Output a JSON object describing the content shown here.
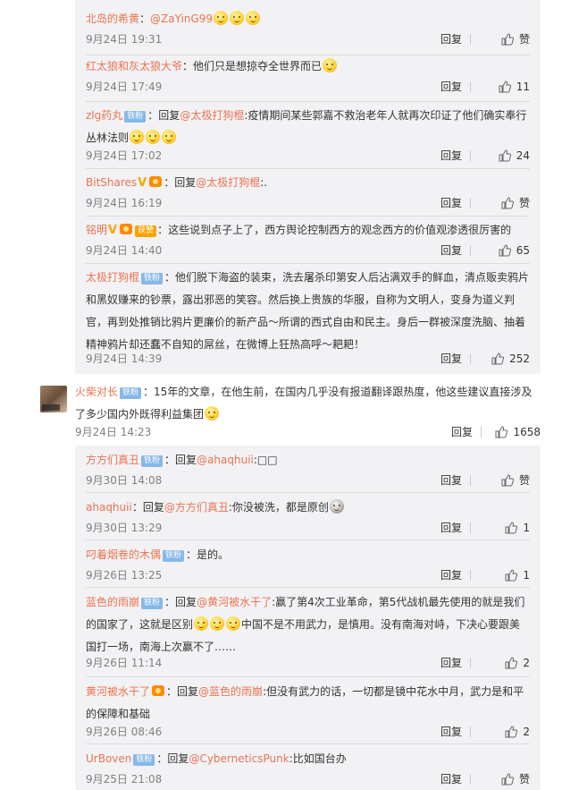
{
  "replies_top": [
    {
      "user": "北岛的希黄",
      "sep": "：",
      "at": "@ZaYinG99",
      "text": "",
      "emojis": 3,
      "time": "9月24日 19:31",
      "likes": "赞"
    },
    {
      "user": "红太狼和灰太狼大爷",
      "sep": "：",
      "text": "他们只是想掠夺全世界而已",
      "emojis_after": 1,
      "time": "9月24日 17:49",
      "likes": "11"
    },
    {
      "user": "zlg药丸",
      "badge": "铁粉",
      "sep": "：",
      "prefix": "回复",
      "at": "@太极打狗棍",
      "text": ":疫情期间某些郭嘉不救治老年人就再次印证了他们确实奉行丛林法则",
      "emojis_after": 3,
      "time": "9月24日 17:02",
      "likes": "24"
    },
    {
      "user": "BitShares",
      "vip": "V",
      "medal": true,
      "sep": "：",
      "prefix": "回复",
      "at": "@太极打狗棍",
      "text": ":.",
      "time": "9月24日 16:19",
      "likes": "赞"
    },
    {
      "user": "铭明",
      "vip": "V",
      "medal": true,
      "badge2": "获赞",
      "sep": "：",
      "text": "这些说到点子上了，西方舆论控制西方的观念西方的价值观渗透很厉害的",
      "time": "9月24日 14:40",
      "likes": "65"
    },
    {
      "user": "太极打狗棍",
      "badge": "铁粉",
      "sep": "：",
      "text": "他们脱下海盗的装束，洗去屠杀印第安人后沾满双手的鲜血，清点贩卖鸦片和黑奴赚来的钞票，露出邪恶的笑容。然后换上贵族的华服，自称为文明人，变身为道义判官，再到处推销比鸦片更廉价的新产品～所谓的西式自由和民主。身后一群被深度洗脑、抽着精神鸦片却还蠢不自知的屌丝，在微博上狂热高呼～耙耙！",
      "time": "9月24日 14:39",
      "likes": "252"
    }
  ],
  "main_comment": {
    "user": "火柴对长",
    "badge": "铁粉",
    "sep": "：",
    "text": "15年的文章，在他生前，在国内几乎没有报道翻译跟热度，他这些建议直接涉及了多少国内外既得利益集团",
    "time": "9月24日 14:23",
    "likes": "1658"
  },
  "replies_bottom": [
    {
      "user": "方方们真丑",
      "badge": "铁粉",
      "sep": "：",
      "prefix": "回复",
      "at": "@ahaqhuii",
      "text": ":□□",
      "time": "9月30日 14:08",
      "likes": "赞"
    },
    {
      "user": "ahaqhuii",
      "sep": "：",
      "prefix": "回复",
      "at": "@方方们真丑",
      "text": ":你没被洗，都是原创",
      "emojis_after": 1,
      "time": "9月30日 13:29",
      "likes": "1"
    },
    {
      "user": "叼着烟卷的木偶",
      "badge": "铁粉",
      "sep": "：",
      "text": "是的。",
      "time": "9月26日 13:25",
      "likes": "1"
    },
    {
      "user": "蓝色的雨崩",
      "badge": "铁粉",
      "sep": "：",
      "prefix": "回复",
      "at": "@黄河被水干了",
      "text": ":赢了第4次工业革命，第5代战机最先使用的就是我们的国家了，这就是区别",
      "text2": "中国不是不用武力，是慎用。没有南海对峙，下决心要跟美国打一场，南海上次赢不了……",
      "time": "9月26日 11:14",
      "likes": "2"
    },
    {
      "user": "黄河被水干了",
      "medal": true,
      "sep": "：",
      "prefix": "回复",
      "at": "@蓝色的雨崩",
      "text": ":但没有武力的话，一切都是镜中花水中月，武力是和平的保障和基础",
      "time": "9月26日 08:46",
      "likes": "2"
    },
    {
      "user": "UrBoven",
      "badge": "铁粉",
      "sep": "：",
      "prefix": "回复",
      "at": "@CyberneticsPunk",
      "text": ":比如国台办",
      "time": "9月25日 21:08",
      "likes": "赞"
    }
  ],
  "ui": {
    "reply_label": "回复"
  },
  "icons": {
    "thumb": "thumbs-up-icon",
    "emoji": "emoji-smile-icon",
    "medal": "medal-icon",
    "vip": "vip-v-icon"
  }
}
